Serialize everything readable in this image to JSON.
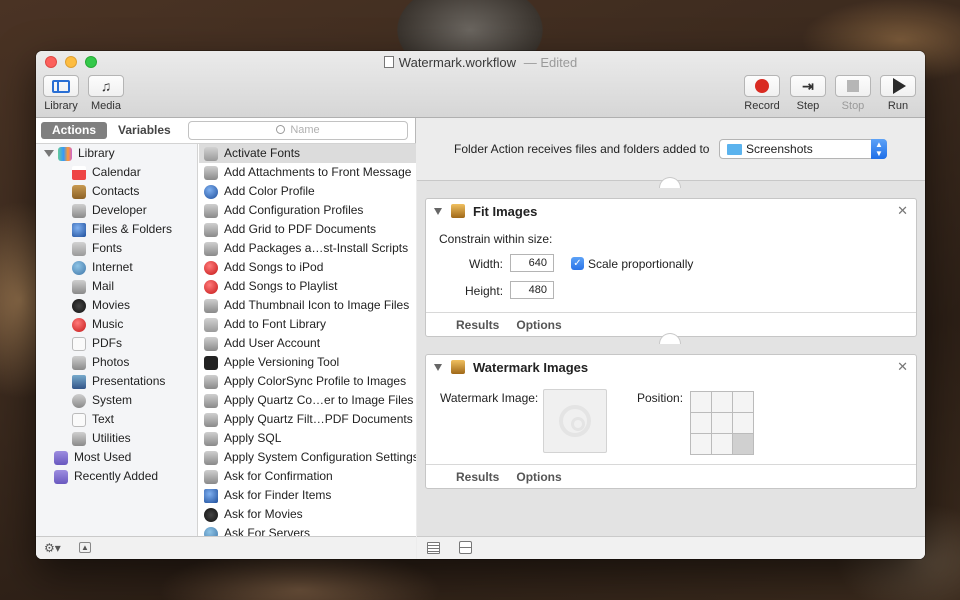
{
  "window": {
    "title": "Watermark.workflow",
    "title_separator": "—",
    "edited_label": "Edited"
  },
  "toolbar": {
    "library_label": "Library",
    "media_label": "Media",
    "record_label": "Record",
    "step_label": "Step",
    "stop_label": "Stop",
    "run_label": "Run"
  },
  "library_pane": {
    "actions_tab": "Actions",
    "variables_tab": "Variables",
    "search_placeholder": "Name",
    "categories": [
      {
        "label": "Library",
        "icon": "library-icon"
      },
      {
        "label": "Calendar",
        "icon": "calendar-icon"
      },
      {
        "label": "Contacts",
        "icon": "contacts-icon"
      },
      {
        "label": "Developer",
        "icon": "developer-tools-icon"
      },
      {
        "label": "Files & Folders",
        "icon": "files-folders-icon"
      },
      {
        "label": "Fonts",
        "icon": "fonts-icon"
      },
      {
        "label": "Internet",
        "icon": "internet-globe-icon"
      },
      {
        "label": "Mail",
        "icon": "mail-icon"
      },
      {
        "label": "Movies",
        "icon": "movies-icon"
      },
      {
        "label": "Music",
        "icon": "music-icon"
      },
      {
        "label": "PDFs",
        "icon": "pdf-icon"
      },
      {
        "label": "Photos",
        "icon": "photos-icon"
      },
      {
        "label": "Presentations",
        "icon": "presentations-icon"
      },
      {
        "label": "System",
        "icon": "system-icon"
      },
      {
        "label": "Text",
        "icon": "text-icon"
      },
      {
        "label": "Utilities",
        "icon": "utilities-icon"
      },
      {
        "label": "Most Used",
        "icon": "smart-folder-icon"
      },
      {
        "label": "Recently Added",
        "icon": "smart-folder-icon"
      }
    ],
    "actions": [
      "Activate Fonts",
      "Add Attachments to Front Message",
      "Add Color Profile",
      "Add Configuration Profiles",
      "Add Grid to PDF Documents",
      "Add Packages a…st-Install Scripts",
      "Add Songs to iPod",
      "Add Songs to Playlist",
      "Add Thumbnail Icon to Image Files",
      "Add to Font Library",
      "Add User Account",
      "Apple Versioning Tool",
      "Apply ColorSync Profile to Images",
      "Apply Quartz Co…er to Image Files",
      "Apply Quartz Filt…PDF Documents",
      "Apply SQL",
      "Apply System Configuration Settings",
      "Ask for Confirmation",
      "Ask for Finder Items",
      "Ask for Movies",
      "Ask For Servers"
    ]
  },
  "workflow": {
    "receives_text": "Folder Action receives files and folders added to",
    "folder_value": "Screenshots",
    "fit_images": {
      "title": "Fit Images",
      "constrain_label": "Constrain within size:",
      "width_label": "Width:",
      "width_value": "640",
      "height_label": "Height:",
      "height_value": "480",
      "scale_label": "Scale proportionally",
      "scale_checked": true,
      "results_label": "Results",
      "options_label": "Options"
    },
    "watermark_images": {
      "title": "Watermark Images",
      "watermark_label": "Watermark Image:",
      "position_label": "Position:",
      "position_selected_cell": 8,
      "results_label": "Results",
      "options_label": "Options"
    }
  },
  "colors": {
    "accent": "#2a74e8",
    "record": "#d92b22"
  }
}
